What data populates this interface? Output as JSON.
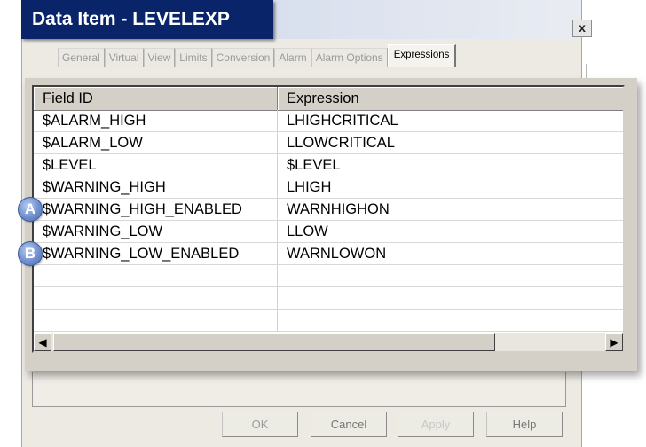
{
  "window": {
    "title": "Data Item - LEVELEXP",
    "close_glyph": "x"
  },
  "tabs": [
    "General",
    "Virtual",
    "View",
    "Limits",
    "Conversion",
    "Alarm",
    "Alarm Options",
    "Expressions"
  ],
  "active_tab": "Expressions",
  "table": {
    "columns": [
      "Field ID",
      "Expression"
    ],
    "rows": [
      [
        "$ALARM_HIGH",
        "LHIGHCRITICAL"
      ],
      [
        "$ALARM_LOW",
        "LLOWCRITICAL"
      ],
      [
        "$LEVEL",
        "$LEVEL"
      ],
      [
        "$WARNING_HIGH",
        "LHIGH"
      ],
      [
        "$WARNING_HIGH_ENABLED",
        "WARNHIGHON"
      ],
      [
        "$WARNING_LOW",
        "LLOW"
      ],
      [
        "$WARNING_LOW_ENABLED",
        "WARNLOWON"
      ]
    ]
  },
  "callouts": [
    "A",
    "B"
  ],
  "buttons": {
    "ok": "OK",
    "cancel": "Cancel",
    "apply": "Apply",
    "help": "Help"
  },
  "scrollbar": {
    "left_icon": "arrow-left-icon",
    "right_icon": "arrow-right-icon"
  }
}
